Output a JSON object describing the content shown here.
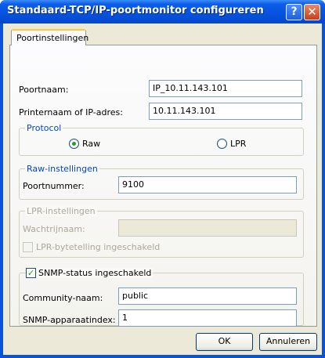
{
  "window": {
    "title": "Standaard-TCP/IP-poortmonitor configureren",
    "help_label": "?",
    "close_label": "✕"
  },
  "tabs": [
    {
      "label": "Poortinstellingen"
    }
  ],
  "port_settings": {
    "port_name_label": "Poortnaam:",
    "port_name_value": "IP_10.11.143.101",
    "printer_label": "Printernaam of IP-adres:",
    "printer_value": "10.11.143.101"
  },
  "protocol": {
    "legend": "Protocol",
    "options": [
      {
        "label": "Raw",
        "selected": true
      },
      {
        "label": "LPR",
        "selected": false
      }
    ]
  },
  "raw_settings": {
    "legend": "Raw-instellingen",
    "port_number_label": "Poortnummer:",
    "port_number_value": "9100"
  },
  "lpr_settings": {
    "legend": "LPR-instellingen",
    "queue_label": "Wachtrijnaam:",
    "queue_value": "",
    "byte_count_label": "LPR-bytetelling ingeschakeld",
    "byte_count_checked": false
  },
  "snmp": {
    "enabled_label": "SNMP-status ingeschakeld",
    "enabled": true,
    "community_label": "Community-naam:",
    "community_value": "public",
    "device_index_label": "SNMP-apparaatindex:",
    "device_index_value": "1"
  },
  "footer": {
    "ok_label": "OK",
    "cancel_label": "Annuleren"
  }
}
